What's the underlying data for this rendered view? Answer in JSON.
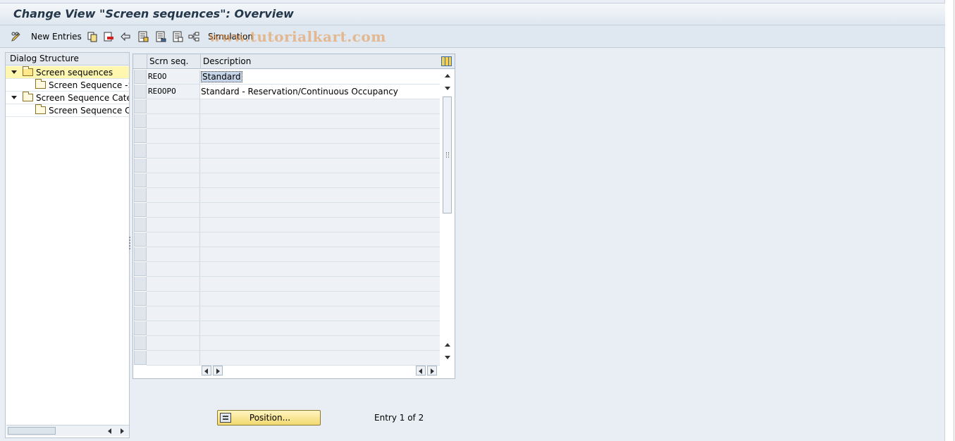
{
  "window": {
    "title": "Change View \"Screen sequences\": Overview"
  },
  "toolbar": {
    "new_entries_label": "New Entries",
    "simulation_label": "Simulation",
    "icons": [
      "pencil-glasses-icon",
      "copy-icon",
      "delete-icon",
      "undo-icon",
      "select-all-icon",
      "select-block-icon",
      "deselect-all-icon",
      "simulation-icon"
    ]
  },
  "watermark": "www.tutorialkart.com",
  "dialog_structure": {
    "header": "Dialog Structure",
    "items": [
      {
        "label": "Screen sequences",
        "level": 0,
        "expanded": true,
        "selected": true
      },
      {
        "label": "Screen Sequence ->",
        "level": 1,
        "expanded": false,
        "selected": false
      },
      {
        "label": "Screen Sequence Categ",
        "level": 0,
        "expanded": true,
        "selected": false
      },
      {
        "label": "Screen Sequence Ca",
        "level": 1,
        "expanded": false,
        "selected": false
      }
    ]
  },
  "table": {
    "columns": [
      "Scrn seq.",
      "Description"
    ],
    "rows": [
      {
        "seq": "REOO",
        "description": "Standard"
      },
      {
        "seq": "REOOPO",
        "description": "Standard - Reservation/Continuous Occupancy"
      }
    ],
    "empty_rows": 18
  },
  "footer": {
    "position_button": "Position...",
    "entry_info": "Entry 1 of 2"
  },
  "colors": {
    "background": "#e8eef4",
    "title_text": "#23364a",
    "selected_tree_row": "#fff7b0",
    "position_button": "#f3d970"
  }
}
